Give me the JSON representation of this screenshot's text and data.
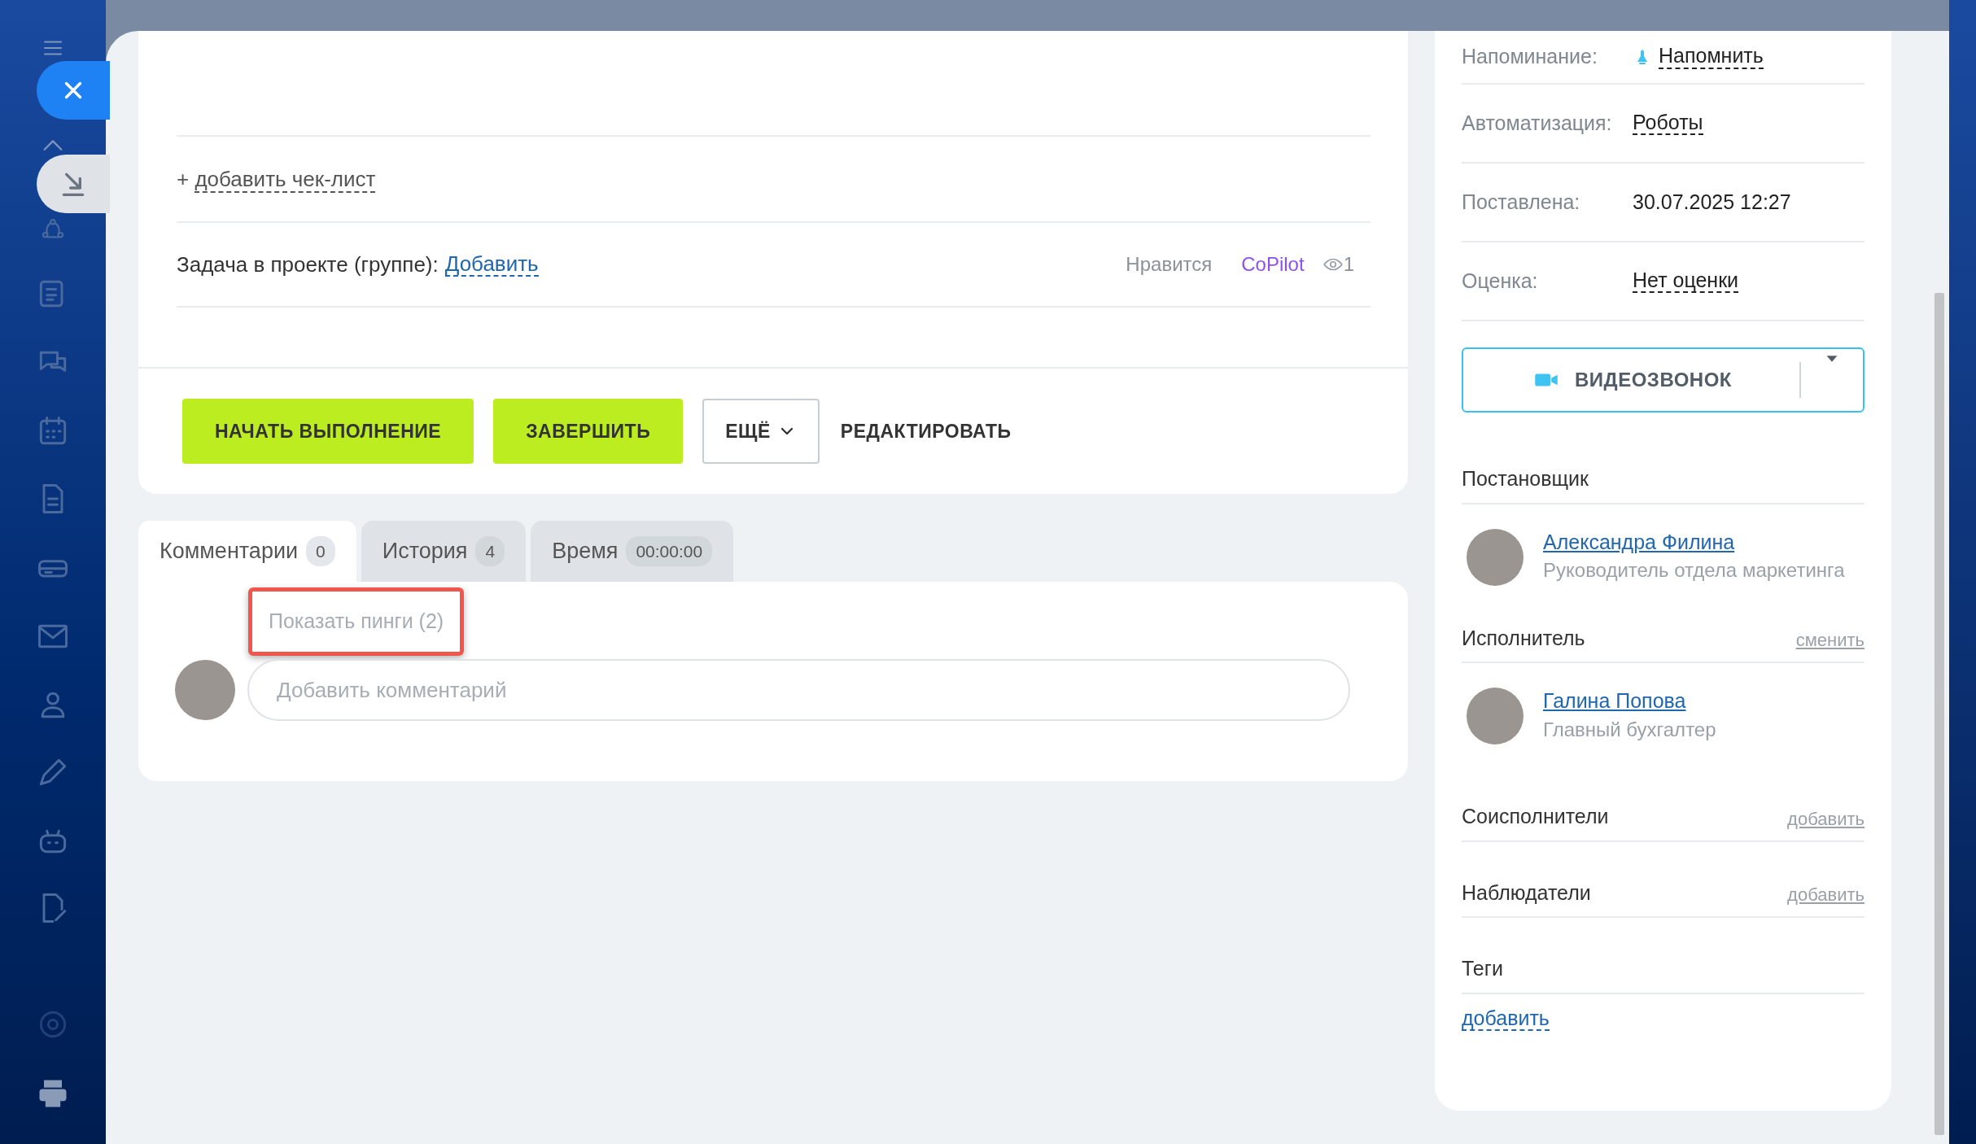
{
  "task_body": {
    "checklist": {
      "prefix": "+",
      "link": "добавить чек-лист"
    },
    "project": {
      "label": "Задача в проекте (группе):",
      "link": "Добавить"
    },
    "reactions": {
      "like": "Нравится",
      "user": "CoPilot",
      "views": "1"
    },
    "actions": [
      {
        "label": "НАЧАТЬ ВЫПОЛНЕНИЕ",
        "kind": "primary"
      },
      {
        "label": "ЗАВЕРШИТЬ",
        "kind": "primary"
      },
      {
        "label": "ЕЩЁ",
        "kind": "dropdown"
      },
      {
        "label": "РЕДАКТИРОВАТЬ",
        "kind": "link"
      }
    ]
  },
  "tabs": [
    {
      "label": "Комментарии",
      "count": "0",
      "selected": true
    },
    {
      "label": "История",
      "count": "4",
      "selected": false
    },
    {
      "label": "Время",
      "count": "00:00:00",
      "selected": false
    }
  ],
  "comments": {
    "pings": {
      "label": "Показать пинги (2)",
      "highlighted": true
    },
    "comment_field": {
      "placeholder": "Добавить комментарий"
    }
  },
  "side_panel": {
    "fields": [
      {
        "label": "Напоминание:",
        "value": "Напомнить",
        "kind": "reminder"
      },
      {
        "label": "Автоматизация:",
        "value": "Роботы",
        "kind": "link"
      },
      {
        "label": "Поставлена:",
        "value": "30.07.2025 12:27",
        "kind": "text"
      },
      {
        "label": "Оценка:",
        "value": "Нет оценки",
        "kind": "link"
      }
    ],
    "video_call": "ВИДЕОЗВОНОК",
    "roles": [
      {
        "title": "Постановщик",
        "people": [
          {
            "name": "Александра Филина",
            "position": "Руководитель отдела маркетинга"
          }
        ]
      },
      {
        "title": "Исполнитель",
        "action": "сменить",
        "people": [
          {
            "name": "Галина Попова",
            "position": "Главный бухгалтер"
          }
        ]
      },
      {
        "title": "Соисполнители",
        "action": "добавить"
      },
      {
        "title": "Наблюдатели",
        "action": "добавить"
      },
      {
        "title": "Теги",
        "link": "добавить"
      }
    ]
  }
}
